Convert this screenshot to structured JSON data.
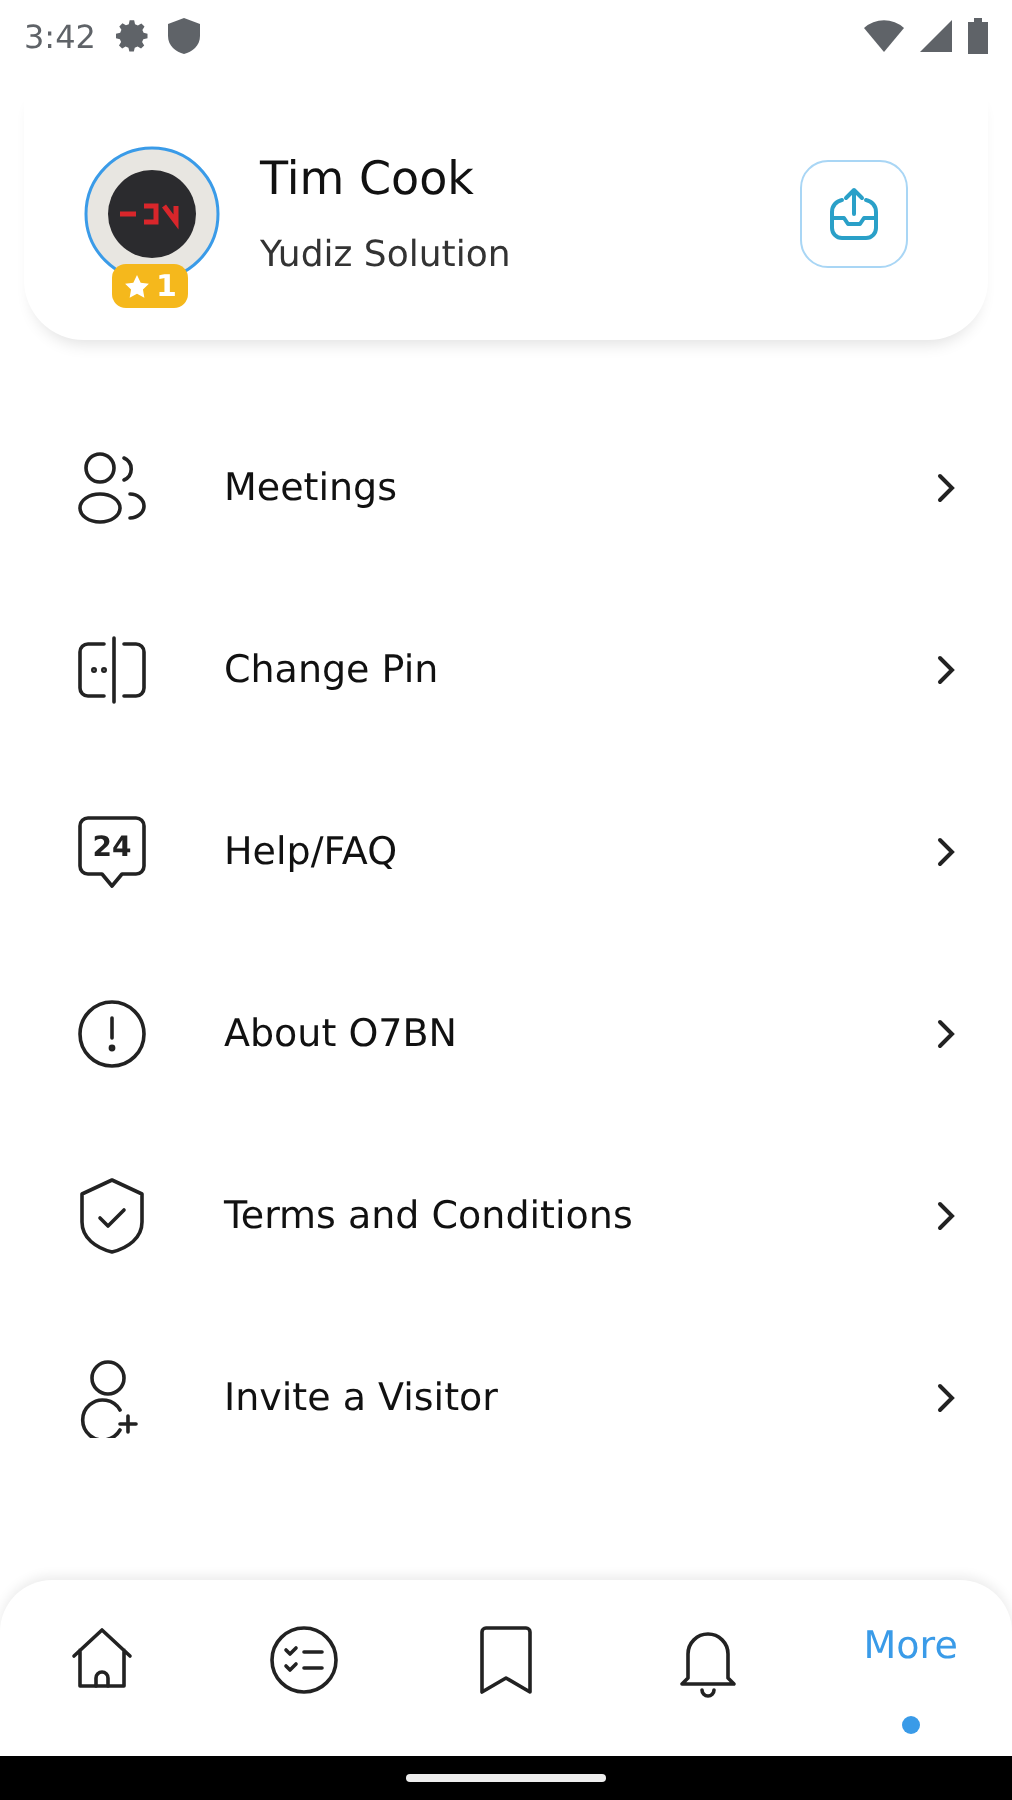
{
  "status_bar": {
    "time": "3:42"
  },
  "profile": {
    "name": "Tim Cook",
    "company": "Yudiz Solution",
    "badge": "1"
  },
  "menu": [
    {
      "kind": "people",
      "label": "Meetings"
    },
    {
      "kind": "pin",
      "label": "Change Pin"
    },
    {
      "kind": "help",
      "label": "Help/FAQ",
      "icon_text": "24"
    },
    {
      "kind": "info",
      "label": "About O7BN"
    },
    {
      "kind": "shield",
      "label": "Terms and Conditions"
    },
    {
      "kind": "invite",
      "label": "Invite a Visitor"
    }
  ],
  "nav": [
    {
      "kind": "home",
      "selected": false
    },
    {
      "kind": "tasks",
      "selected": false
    },
    {
      "kind": "bookmark",
      "selected": false
    },
    {
      "kind": "bell",
      "selected": false
    },
    {
      "kind": "more",
      "label": "More",
      "selected": true
    }
  ]
}
